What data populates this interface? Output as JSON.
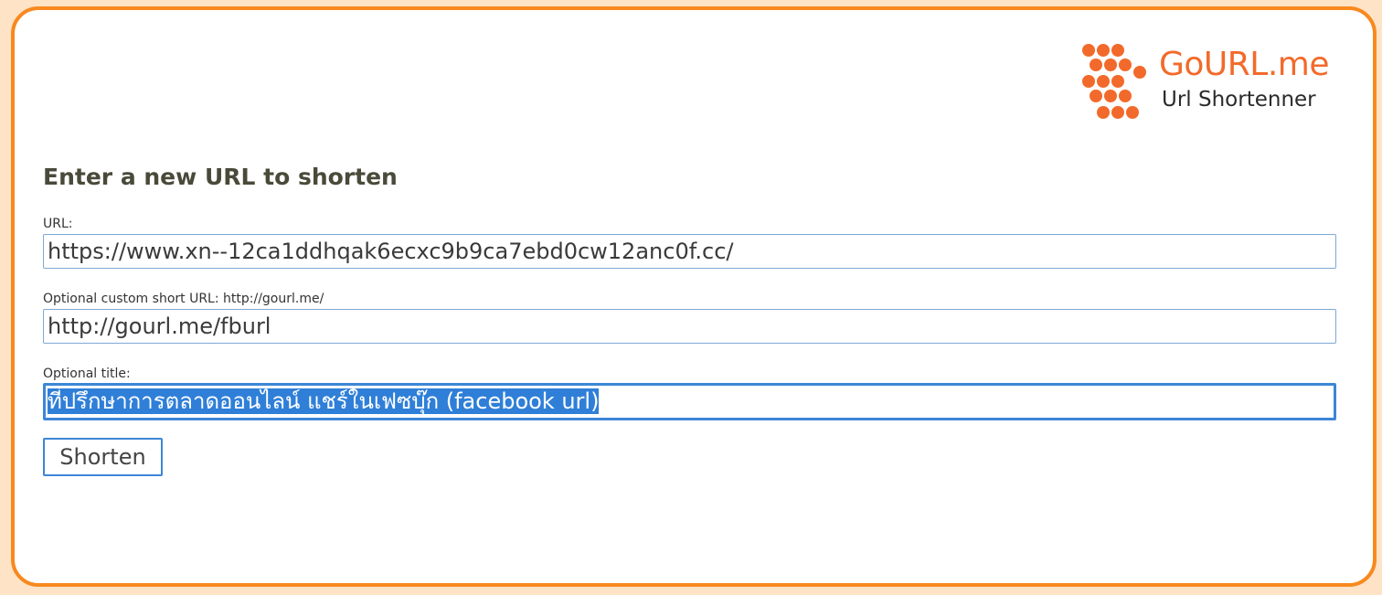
{
  "logo": {
    "name": "GoURL.me",
    "tagline": "Url Shortenner",
    "color": "#f26a2b"
  },
  "form": {
    "heading": "Enter a new URL to shorten",
    "url": {
      "label": "URL:",
      "value": "https://www.xn--12ca1ddhqak6ecxc9b9ca7ebd0cw12anc0f.cc/"
    },
    "custom": {
      "label": "Optional custom short URL: http://gourl.me/",
      "value": "http://gourl.me/fburl"
    },
    "title": {
      "label": "Optional title:",
      "value": "ที่ปรึกษาการตลาดออนไลน์ แชร์ในเฟซบุ๊ก (facebook url)"
    },
    "submit_label": "Shorten"
  },
  "colors": {
    "border_accent": "#f7891e",
    "page_background": "#ffe3c6",
    "focus_blue": "#3d86d6"
  }
}
